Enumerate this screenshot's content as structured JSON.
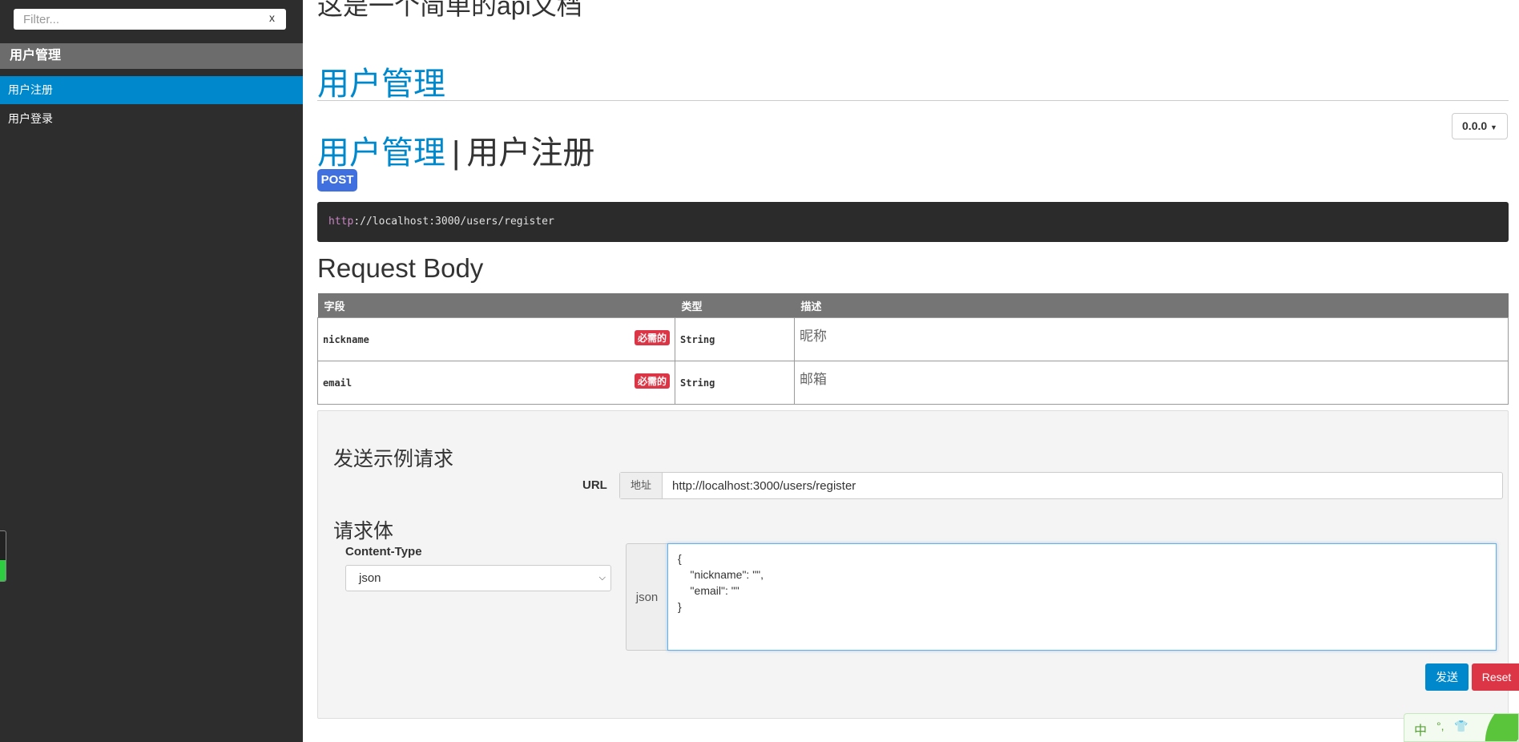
{
  "sidebar": {
    "filter_placeholder": "Filter...",
    "filter_clear": "x",
    "group_label": "用户管理",
    "items": [
      {
        "label": "用户注册",
        "active": true
      },
      {
        "label": "用户登录",
        "active": false
      }
    ]
  },
  "main": {
    "doc_title": "这是一个简单的api文档",
    "group_title": "用户管理",
    "version": "0.0.0",
    "api_title": {
      "group": "用户管理",
      "separator": "|",
      "name": "用户注册"
    },
    "method": "POST",
    "endpoint": {
      "protocol": "http",
      "rest": "://localhost:3000/users/register"
    },
    "request_body_title": "Request Body",
    "table": {
      "headers": [
        "字段",
        "类型",
        "描述"
      ],
      "rows": [
        {
          "field": "nickname",
          "required_label": "必需的",
          "type": "String",
          "desc": "昵称"
        },
        {
          "field": "email",
          "required_label": "必需的",
          "type": "String",
          "desc": "邮箱"
        }
      ]
    }
  },
  "sample": {
    "title": "发送示例请求",
    "url_label": "URL",
    "url_addon": "地址",
    "url_value": "http://localhost:3000/users/register",
    "body_title": "请求体",
    "content_type_label": "Content-Type",
    "content_type_value": "json",
    "json_addon": "json",
    "json_body": "{\n    \"nickname\": \"\",\n    \"email\": \"\"\n}",
    "send_label": "发送",
    "reset_label": "Reset"
  },
  "ime": {
    "mode": "中",
    "punct": "°,",
    "skin": "👕"
  },
  "colors": {
    "accent": "#0088cc",
    "sidebar_bg": "#2d2d2d",
    "method_badge": "#4070e0",
    "danger": "#dc3545"
  }
}
